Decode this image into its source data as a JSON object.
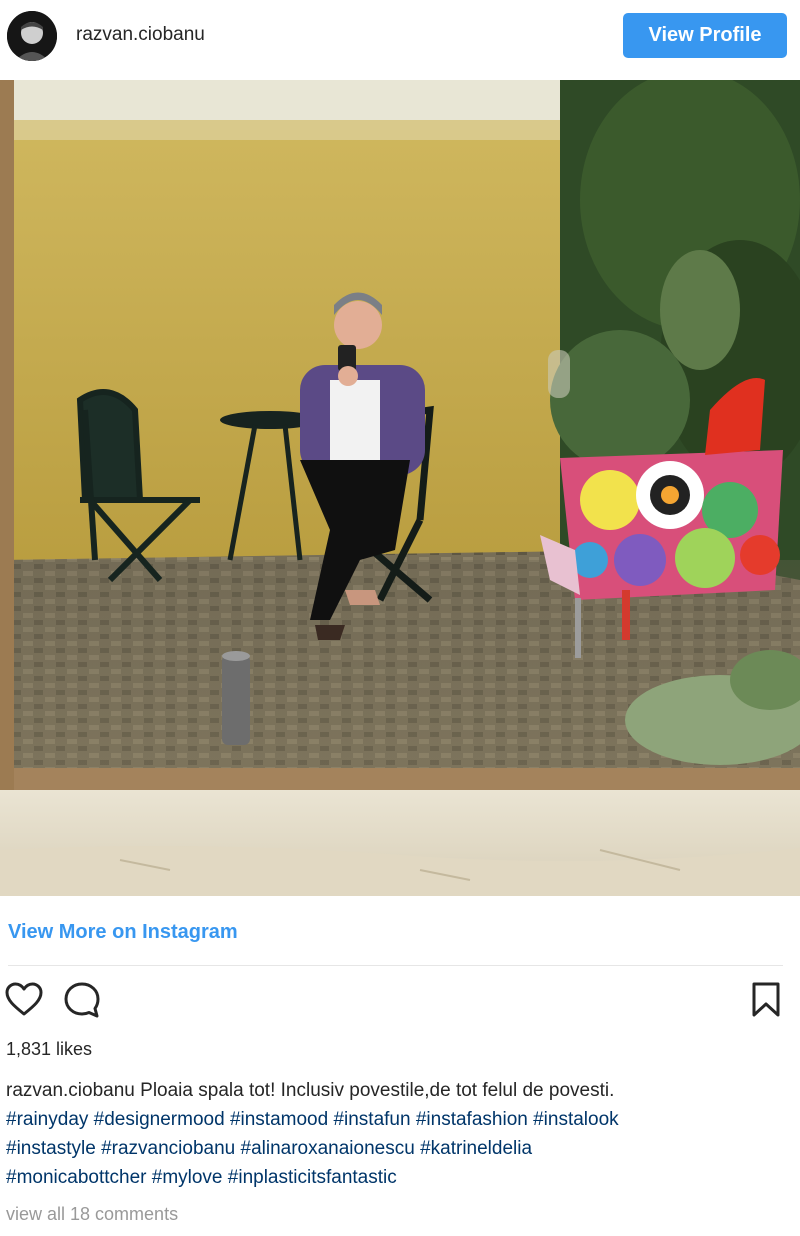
{
  "header": {
    "username": "razvan.ciobanu",
    "view_profile_label": "View Profile"
  },
  "post": {
    "view_more_label": "View More on Instagram",
    "likes": "1,831 likes",
    "caption_author": "razvan.ciobanu",
    "caption_text": "Ploaia spala tot! Inclusiv povestile,de tot felul de povesti.",
    "hashtags": [
      "#rainyday",
      "#designermood",
      "#instamood",
      "#instafun",
      "#instafashion",
      "#instalook",
      "#instastyle",
      "#razvanciobanu",
      "#alinaroxanaionescu",
      "#katrineldelia",
      "#monicabottcher",
      "#mylove",
      "#inplasticitsfantastic"
    ],
    "comments_label": "view all 18 comments"
  },
  "icons": {
    "like": "heart-icon",
    "comment": "comment-icon",
    "save": "bookmark-icon"
  },
  "colors": {
    "accent": "#3897f0",
    "hashtag": "#003569",
    "muted": "#999999"
  }
}
